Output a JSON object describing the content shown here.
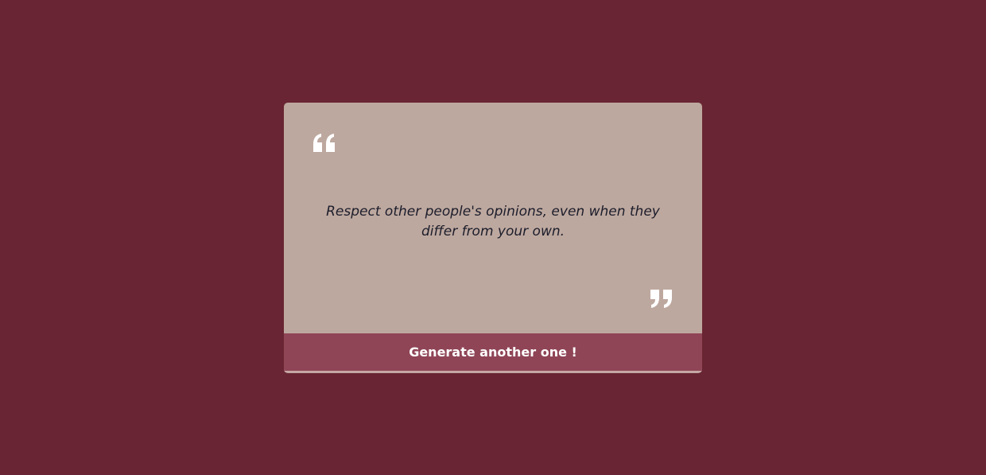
{
  "quote": {
    "text": "Respect other people's opinions, even when they differ from your own.",
    "open_icon": "quote-open-icon",
    "close_icon": "quote-close-icon"
  },
  "button": {
    "label": "Generate another one !"
  },
  "colors": {
    "background": "#692533",
    "card": "#bda89f",
    "button": "#8f4556",
    "quote_text": "#1c1d2b",
    "icon": "#ffffff"
  }
}
